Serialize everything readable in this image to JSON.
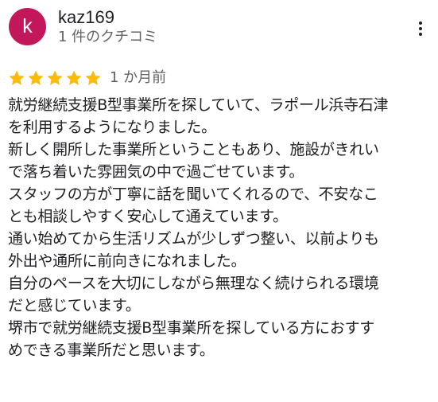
{
  "colors": {
    "avatar_bg": "#c2185b",
    "star": "#fbbc04",
    "text": "#202124",
    "secondary_text": "#5f6368"
  },
  "review": {
    "author": {
      "avatar_letter": "k",
      "name": "kaz169",
      "meta": "1 件のクチコミ"
    },
    "menu_icon": "more-vert-icon",
    "rating": 5,
    "rating_max": 5,
    "date": "1 か月前",
    "lines": [
      "就労継続支援B型事業所を探していて、ラポール浜寺石津",
      "を利用するようになりました。",
      "新しく開所した事業所ということもあり、施設がきれい",
      "で落ち着いた雰囲気の中で過ごせています。",
      "スタッフの方が丁寧に話を聞いてくれるので、不安なこ",
      "とも相談しやすく安心して通えています。",
      "通い始めてから生活リズムが少しずつ整い、以前よりも",
      "外出や通所に前向きになれました。",
      "自分のペースを大切にしながら無理なく続けられる環境",
      "だと感じています。",
      "堺市で就労継続支援B型事業所を探している方におすす",
      "めできる事業所だと思います。"
    ]
  }
}
